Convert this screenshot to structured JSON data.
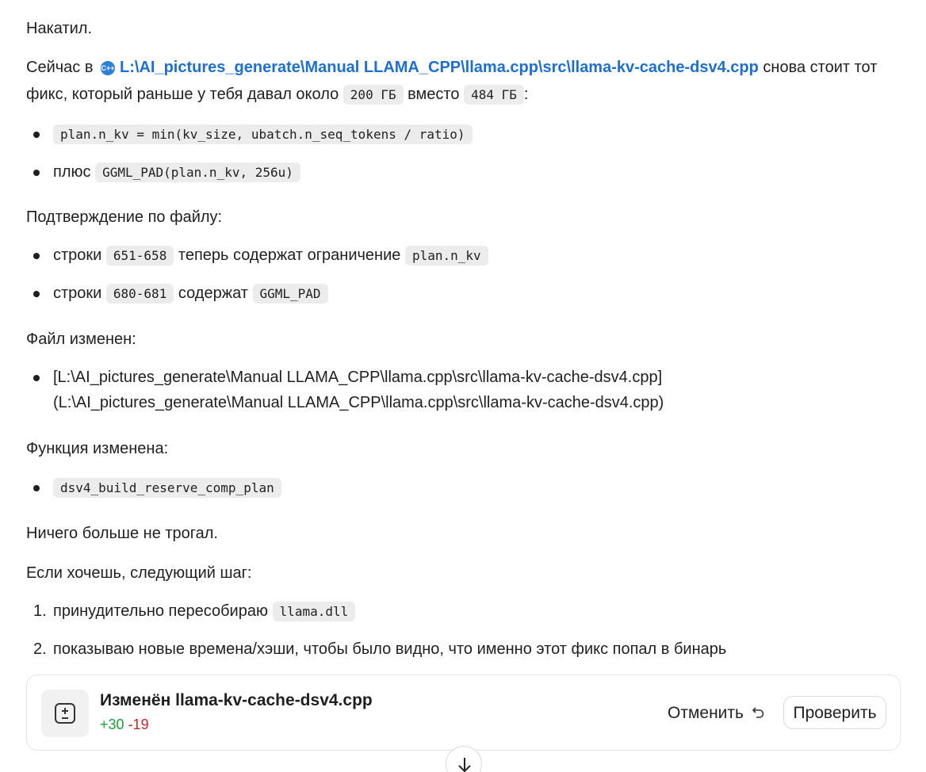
{
  "message": {
    "p1": "Накатил.",
    "p2_before": "Сейчас в",
    "file_icon_label": "C++",
    "file_path": "L:\\AI_pictures_generate\\Manual LLAMA_CPP\\llama.cpp\\src\\llama-kv-cache-dsv4.cpp",
    "p2_after": "снова стоит тот фикс, который раньше у тебя давал около",
    "p2_code1": "200 ГБ",
    "p2_mid": "вместо",
    "p2_code2": "484 ГБ",
    "p2_end": ":",
    "list1": [
      {
        "text": "",
        "code": "plan.n_kv = min(kv_size, ubatch.n_seq_tokens / ratio)"
      },
      {
        "text": "плюс",
        "code": "GGML_PAD(plan.n_kv, 256u)"
      }
    ],
    "p3": "Подтверждение по файлу:",
    "list2": [
      {
        "text1": "строки",
        "code1": "651-658",
        "text2": "теперь содержат ограничение",
        "code2": "plan.n_kv"
      },
      {
        "text1": "строки",
        "code1": "680-681",
        "text2": "содержат",
        "code2": "GGML_PAD"
      }
    ],
    "p4": "Файл изменен:",
    "list3_line1": "[L:\\AI_pictures_generate\\Manual LLAMA_CPP\\llama.cpp\\src\\llama-kv-cache-dsv4.cpp]",
    "list3_line2": "(L:\\AI_pictures_generate\\Manual LLAMA_CPP\\llama.cpp\\src\\llama-kv-cache-dsv4.cpp)",
    "p5": "Функция изменена:",
    "list4_code": "dsv4_build_reserve_comp_plan",
    "p6": "Ничего больше не трогал.",
    "p7": "Если хочешь, следующий шаг:",
    "ordered": [
      {
        "num": "1.",
        "text": "принудительно пересобираю",
        "code": "llama.dll"
      },
      {
        "num": "2.",
        "text": "показываю новые времена/хэши, чтобы было видно, что именно этот фикс попал в бинарь",
        "code": ""
      }
    ]
  },
  "card": {
    "title": "Изменён llama-kv-cache-dsv4.cpp",
    "additions": "+30",
    "deletions": "-19",
    "cancel_label": "Отменить",
    "check_label": "Проверить",
    "icon": "diff-icon"
  },
  "scroll_button": {
    "icon": "arrow-down-icon"
  }
}
